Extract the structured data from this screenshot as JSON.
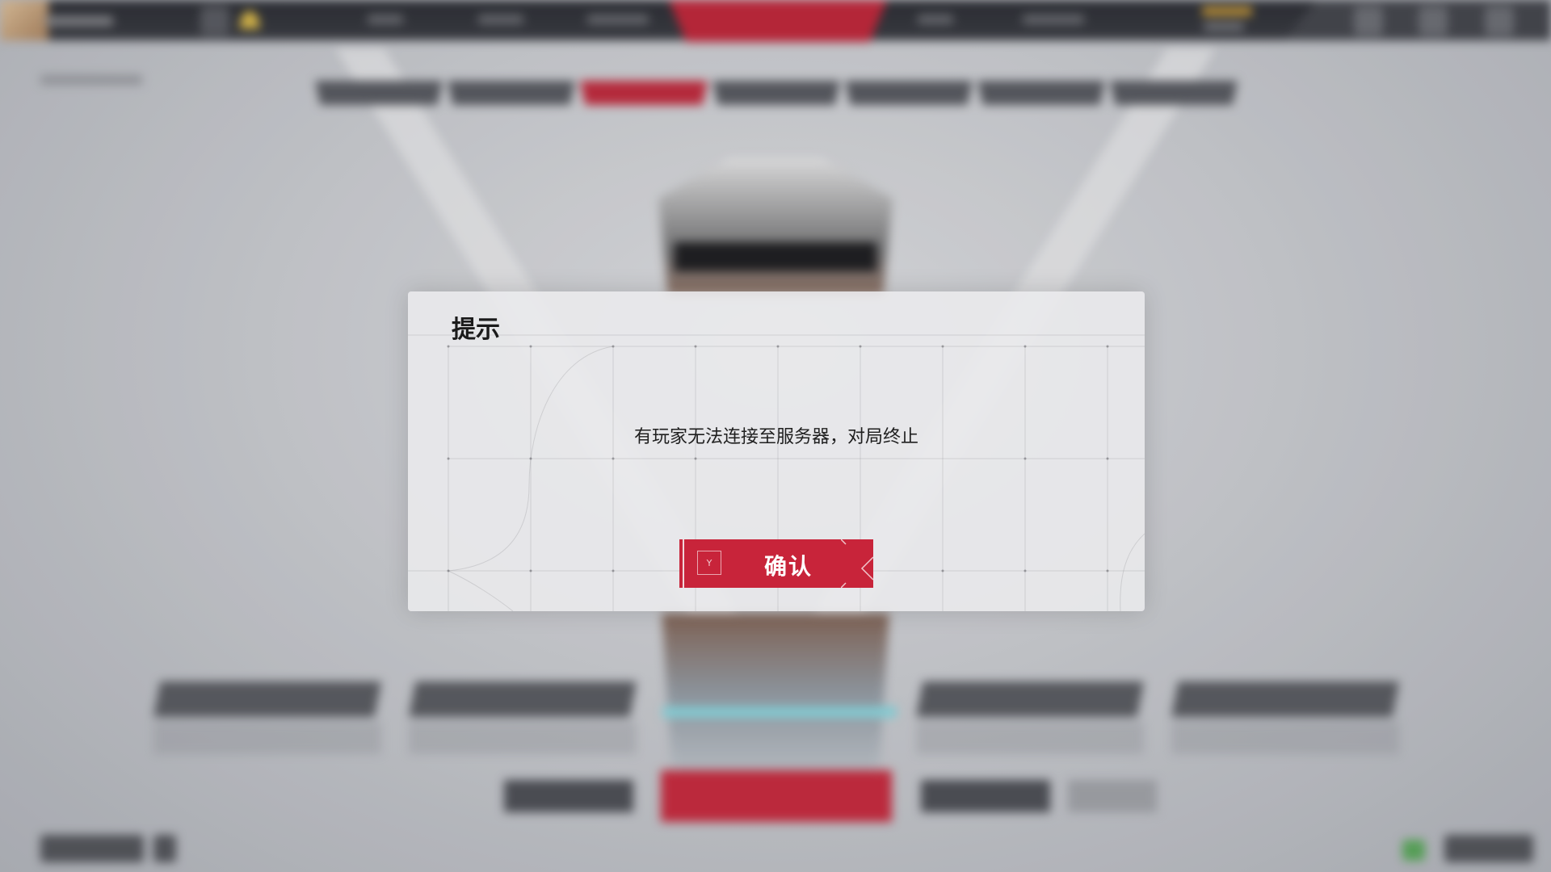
{
  "dialog": {
    "title": "提示",
    "message": "有玩家无法连接至服务器，对局终止",
    "confirm": {
      "key_hint": "Y",
      "label": "确认"
    }
  },
  "colors": {
    "accent_red": "#c8243a",
    "topbar": "#2b2d33",
    "dialog_bg": "#ebebed"
  },
  "icons": [
    "avatar",
    "mail-icon",
    "notification-bell-icon",
    "shop-icon",
    "settings-icon",
    "controller-key-icon"
  ]
}
